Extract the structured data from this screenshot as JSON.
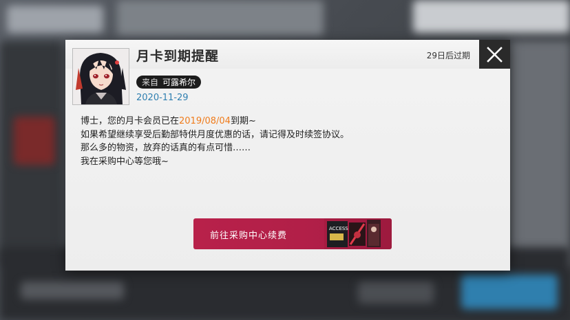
{
  "dialog": {
    "title": "月卡到期提醒",
    "expiry": "29日后过期",
    "from_label": "来自",
    "sender": "可露希尔",
    "date": "2020-11-29",
    "body": {
      "line1_prefix": "博士，您的月卡会员已在",
      "line1_date": "2019/08/04",
      "line1_suffix": "到期~",
      "line2": "如果希望继续享受后勤部特供月度优惠的话，请记得及时续签协议。",
      "line3": "那么多的物资，放弃的话真的有点可惜……",
      "line4": "我在采购中心等您哦~"
    },
    "button_label": "前往采购中心续费",
    "button_art_text": "ACCESS"
  },
  "colors": {
    "accent": "#b8214a",
    "highlight": "#f07c1c",
    "date": "#2f7fb0"
  }
}
